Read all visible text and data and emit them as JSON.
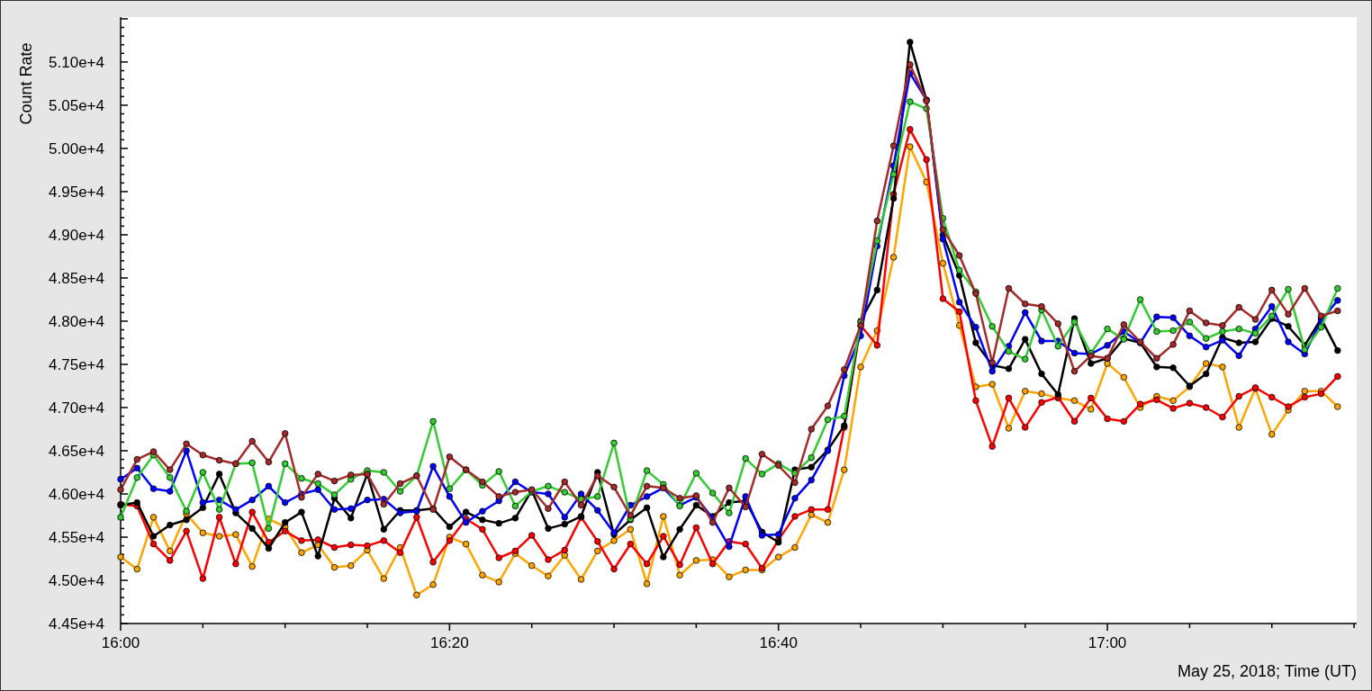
{
  "chart_data": {
    "type": "line",
    "xlabel": "May 25, 2018; Time (UT)",
    "ylabel": "Count Rate",
    "categories": [
      "16:00",
      null,
      null,
      null,
      null,
      null,
      null,
      null,
      null,
      null,
      null,
      null,
      null,
      null,
      null,
      null,
      null,
      null,
      null,
      null,
      "16:20",
      null,
      null,
      null,
      null,
      null,
      null,
      null,
      null,
      null,
      null,
      null,
      null,
      null,
      null,
      null,
      null,
      null,
      null,
      null,
      "16:40",
      null,
      null,
      null,
      null,
      null,
      null,
      null,
      null,
      null,
      null,
      null,
      null,
      null,
      null,
      null,
      null,
      null,
      null,
      null,
      "17:00",
      null,
      null,
      null,
      null,
      null,
      null,
      null,
      null,
      null,
      null,
      null,
      null,
      null,
      null
    ],
    "series": [
      {
        "color": "#ffa500",
        "marker": "circle",
        "values": [
          45270,
          45130,
          45730,
          45340,
          45770,
          45550,
          45510,
          45530,
          45160,
          45710,
          45620,
          45320,
          45410,
          45150,
          45170,
          45350,
          45020,
          45380,
          44830,
          44950,
          45500,
          45420,
          45060,
          44980,
          45310,
          45170,
          45050,
          45290,
          45010,
          45340,
          45460,
          45590,
          44960,
          45740,
          45060,
          45230,
          45240,
          45040,
          45120,
          45120,
          45270,
          45380,
          45760,
          45670,
          46280,
          47470,
          47890,
          48740,
          50020,
          49610,
          48670,
          47950,
          47240,
          47270,
          46760,
          47190,
          47160,
          47110,
          47080,
          46980,
          47510,
          47350,
          47000,
          47130,
          47080,
          47240,
          47510,
          47470,
          46770,
          47220,
          46690,
          46970,
          47190,
          47190,
          47010
        ]
      },
      {
        "color": "#ff0000",
        "marker": "circle",
        "values": [
          45880,
          45860,
          45420,
          45230,
          45570,
          45020,
          45730,
          45190,
          45790,
          45440,
          45570,
          45460,
          45470,
          45380,
          45410,
          45400,
          45460,
          45320,
          45730,
          45210,
          45460,
          45710,
          45590,
          45260,
          45340,
          45520,
          45240,
          45350,
          45730,
          45450,
          45130,
          45420,
          45190,
          45510,
          45180,
          45610,
          45190,
          45450,
          45420,
          45140,
          45470,
          45740,
          45820,
          45820,
          46770,
          47950,
          47720,
          49470,
          50220,
          49870,
          48260,
          48110,
          47080,
          46550,
          47110,
          46770,
          47060,
          47120,
          46840,
          47110,
          46870,
          46840,
          47040,
          47090,
          46990,
          47050,
          47000,
          46890,
          47130,
          47230,
          47120,
          47010,
          47120,
          47160,
          47360
        ]
      },
      {
        "color": "#000000",
        "marker": "circle",
        "values": [
          45870,
          45900,
          45510,
          45640,
          45700,
          45840,
          46230,
          45780,
          45600,
          45370,
          45670,
          45790,
          45280,
          45950,
          45720,
          46230,
          45590,
          45810,
          45810,
          45830,
          45620,
          45790,
          45700,
          45660,
          45720,
          46040,
          45600,
          45650,
          45740,
          46250,
          45530,
          45700,
          45840,
          45270,
          45590,
          45870,
          45740,
          45900,
          45920,
          45560,
          45440,
          46280,
          46310,
          46510,
          46790,
          48000,
          48360,
          49420,
          51230,
          50560,
          49000,
          48530,
          47750,
          47490,
          47450,
          47790,
          47390,
          47150,
          48030,
          47510,
          47570,
          47800,
          47750,
          47470,
          47460,
          47250,
          47390,
          47810,
          47750,
          47760,
          48030,
          47940,
          47720,
          48030,
          47660
        ]
      },
      {
        "color": "#0000ff",
        "marker": "circle",
        "values": [
          46170,
          46300,
          46060,
          46030,
          46500,
          45900,
          45930,
          45820,
          45930,
          46090,
          45900,
          46000,
          46050,
          45820,
          45830,
          45930,
          45940,
          45780,
          45800,
          46320,
          45970,
          45670,
          45800,
          45920,
          46140,
          46020,
          46000,
          45730,
          46000,
          45810,
          45550,
          45870,
          45970,
          46070,
          45870,
          45960,
          45720,
          45390,
          45970,
          45520,
          45530,
          45950,
          46160,
          46500,
          47370,
          47830,
          48870,
          49800,
          50870,
          50560,
          48950,
          48220,
          47930,
          47420,
          47710,
          48100,
          47770,
          47770,
          47630,
          47620,
          47720,
          47880,
          47750,
          48050,
          48040,
          47830,
          47700,
          47780,
          47600,
          47910,
          48170,
          47760,
          47620,
          48010,
          48240
        ]
      },
      {
        "color": "#33cc33",
        "marker": "circle",
        "values": [
          45730,
          46190,
          46450,
          46190,
          45800,
          46250,
          45820,
          46350,
          46360,
          45600,
          46350,
          46180,
          46120,
          45990,
          46170,
          46270,
          46250,
          46030,
          46210,
          46840,
          46060,
          46280,
          46100,
          46260,
          45860,
          46030,
          46090,
          46020,
          45940,
          45970,
          46590,
          45710,
          46270,
          46110,
          45860,
          46240,
          46010,
          45780,
          46410,
          46230,
          46350,
          46240,
          46420,
          46860,
          46900,
          47990,
          48930,
          49700,
          50540,
          50460,
          49190,
          48590,
          48340,
          47940,
          47650,
          47560,
          48130,
          47710,
          47990,
          47630,
          47910,
          47790,
          48250,
          47880,
          47890,
          47990,
          47800,
          47880,
          47910,
          47860,
          48060,
          48370,
          47670,
          47930,
          48380
        ]
      },
      {
        "color": "#a52a2a",
        "marker": "circle",
        "values": [
          46050,
          46400,
          46490,
          46280,
          46580,
          46450,
          46390,
          46350,
          46610,
          46370,
          46700,
          45960,
          46230,
          46150,
          46220,
          46230,
          45880,
          46120,
          46210,
          45820,
          46430,
          46280,
          46140,
          45970,
          46020,
          46050,
          45830,
          46140,
          45870,
          46210,
          46080,
          45750,
          46090,
          46070,
          45950,
          45980,
          45670,
          46070,
          45850,
          46460,
          46330,
          46130,
          46750,
          47020,
          47440,
          47950,
          49160,
          50030,
          50970,
          50550,
          49060,
          48760,
          48320,
          47520,
          48380,
          48200,
          48170,
          47970,
          47420,
          47600,
          47570,
          47960,
          47760,
          47570,
          47730,
          48120,
          47980,
          47950,
          48160,
          48020,
          48360,
          48080,
          48380,
          48060,
          48120
        ]
      }
    ],
    "ylim": [
      44500,
      51520
    ],
    "yticks": [
      {
        "value": 44500,
        "label": "4.45e+4"
      },
      {
        "value": 45000,
        "label": "4.50e+4"
      },
      {
        "value": 45500,
        "label": "4.55e+4"
      },
      {
        "value": 46000,
        "label": "4.60e+4"
      },
      {
        "value": 46500,
        "label": "4.65e+4"
      },
      {
        "value": 47000,
        "label": "4.70e+4"
      },
      {
        "value": 47500,
        "label": "4.75e+4"
      },
      {
        "value": 48000,
        "label": "4.80e+4"
      },
      {
        "value": 48500,
        "label": "4.85e+4"
      },
      {
        "value": 49000,
        "label": "4.90e+4"
      },
      {
        "value": 49500,
        "label": "4.95e+4"
      },
      {
        "value": 50000,
        "label": "5.00e+4"
      },
      {
        "value": 50500,
        "label": "5.05e+4"
      },
      {
        "value": 51000,
        "label": "5.10e+4"
      }
    ]
  }
}
